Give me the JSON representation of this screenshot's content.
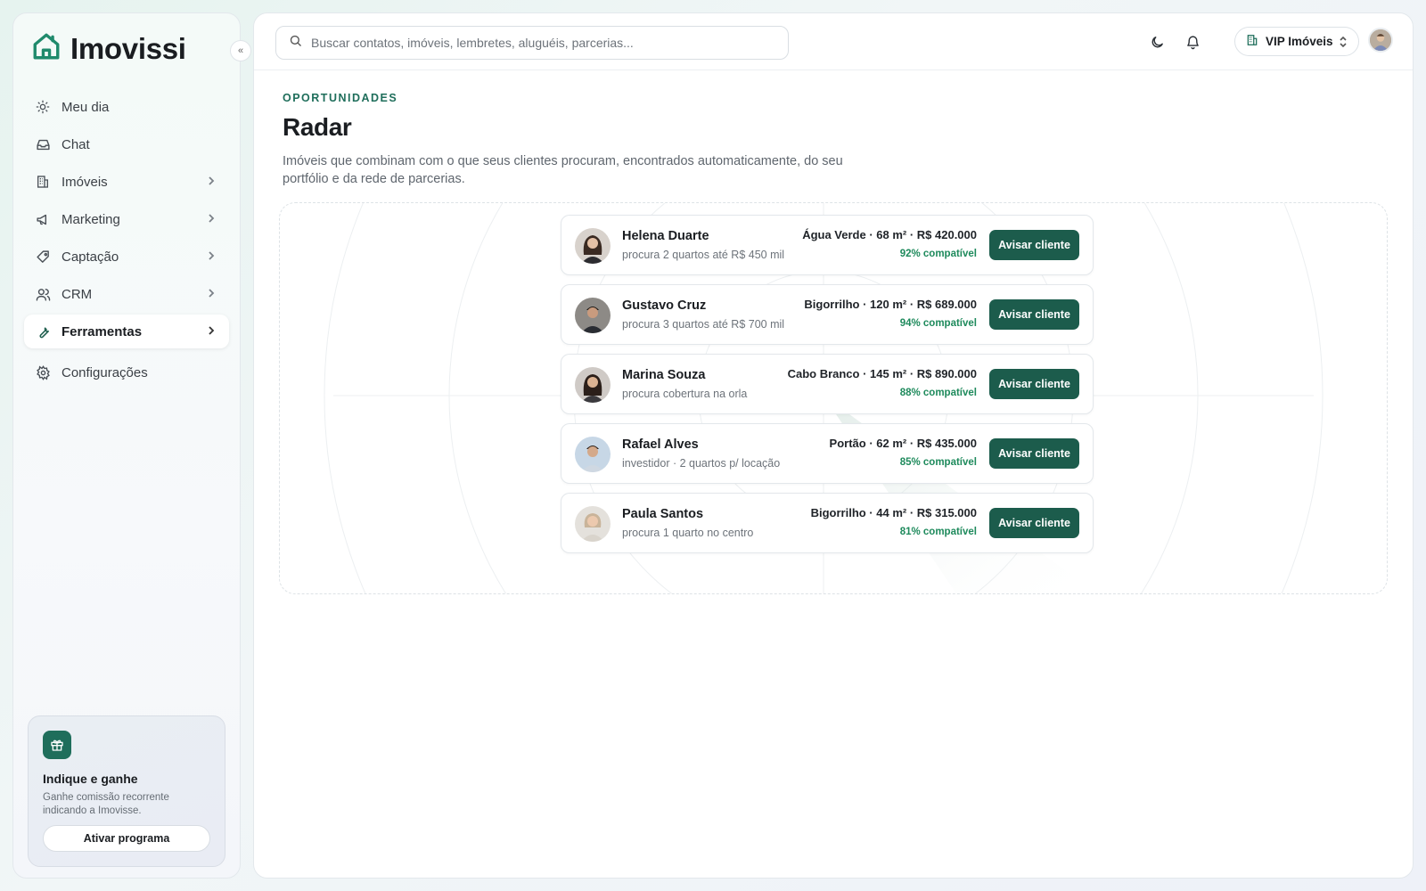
{
  "brand": {
    "name": "Imovissi"
  },
  "sidebar": {
    "items": [
      {
        "label": "Meu dia",
        "icon": "sun-icon"
      },
      {
        "label": "Chat",
        "icon": "inbox-icon"
      },
      {
        "label": "Imóveis",
        "icon": "building-icon"
      },
      {
        "label": "Marketing",
        "icon": "megaphone-icon"
      },
      {
        "label": "Captação",
        "icon": "tag-icon"
      },
      {
        "label": "CRM",
        "icon": "users-icon"
      },
      {
        "label": "Ferramentas",
        "icon": "wrench-icon",
        "active": true
      },
      {
        "label": "Configurações",
        "icon": "gear-icon"
      }
    ]
  },
  "promo": {
    "title": "Indique e ganhe",
    "description": "Ganhe comissão recorrente indicando a Imovisse.",
    "button": "Ativar programa",
    "icon": "gift-icon"
  },
  "topbar": {
    "search_placeholder": "Buscar contatos, imóveis, lembretes, aluguéis, parcerias...",
    "org_name": "VIP Imóveis"
  },
  "page": {
    "eyebrow": "OPORTUNIDADES",
    "title": "Radar",
    "description": "Imóveis que combinam com o que seus clientes procuram, encontrados automaticamente, do seu portfólio e da rede de parcerias."
  },
  "matches": [
    {
      "name": "Helena Duarte",
      "request": "procura 2 quartos até R$ 450 mil",
      "property": "Água Verde · 68 m² · R$ 420.000",
      "compat": "92% compatível",
      "button": "Avisar cliente"
    },
    {
      "name": "Gustavo Cruz",
      "request": "procura 3 quartos até R$ 700 mil",
      "property": "Bigorrilho · 120 m² · R$ 689.000",
      "compat": "94% compatível",
      "button": "Avisar cliente"
    },
    {
      "name": "Marina Souza",
      "request": "procura cobertura na orla",
      "property": "Cabo Branco · 145 m² · R$ 890.000",
      "compat": "88% compatível",
      "button": "Avisar cliente"
    },
    {
      "name": "Rafael Alves",
      "request": "investidor · 2 quartos p/ locação",
      "property": "Portão · 62 m² · R$ 435.000",
      "compat": "85% compatível",
      "button": "Avisar cliente"
    },
    {
      "name": "Paula Santos",
      "request": "procura 1 quarto no centro",
      "property": "Bigorrilho · 44 m² · R$ 315.000",
      "compat": "81% compatível",
      "button": "Avisar cliente"
    }
  ],
  "colors": {
    "accent": "#1c5c4c",
    "compat": "#1e8a5c",
    "eyebrow": "#1f6e5b"
  }
}
